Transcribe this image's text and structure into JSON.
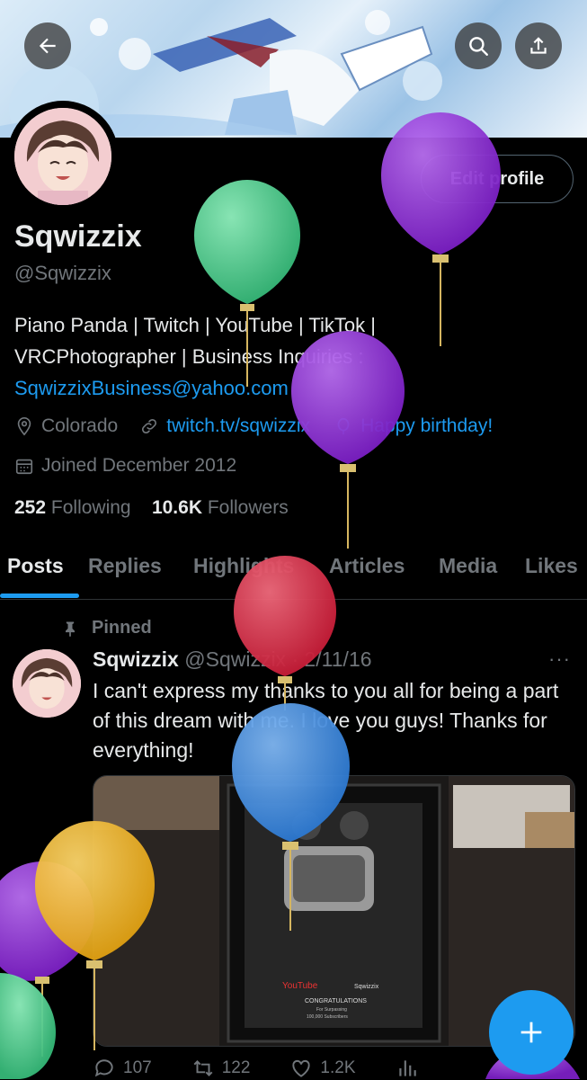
{
  "header": {
    "back_icon": "arrow-left-icon",
    "search_icon": "search-icon",
    "share_icon": "share-icon"
  },
  "profile": {
    "edit_label": "Edit profile",
    "name": "Sqwizzix",
    "handle": "@Sqwizzix",
    "bio_line1": "Piano Panda | Twitch | YouTube | TikTok |",
    "bio_line2": "VRCPhotographer | Business Inquiries :",
    "bio_email": "SqwizzixBusiness@yahoo.com",
    "location": "Colorado",
    "website": "twitch.tv/sqwizzix",
    "birthday": "Happy birthday!",
    "joined": "Joined December 2012",
    "following_count": "252",
    "following_label": "Following",
    "followers_count": "10.6K",
    "followers_label": "Followers"
  },
  "tabs": [
    "Posts",
    "Replies",
    "Highlights",
    "Articles",
    "Media",
    "Likes"
  ],
  "active_tab": "Posts",
  "post": {
    "pinned_label": "Pinned",
    "author": "Sqwizzix",
    "handle": "@Sqwizzix",
    "date": "· 2/11/16",
    "more": "···",
    "text": "I can't express my thanks to you all for being a part of this dream with me. I love you guys! Thanks for everything!",
    "media_caption_channel": "Sqwizzix",
    "media_caption_title": "CONGRATULATIONS",
    "media_caption_sub": "For Surpassing",
    "media_caption_subs": "100,000 Subscribers",
    "media_logo": "YouTube",
    "replies": "107",
    "reposts": "122",
    "likes": "1.2K"
  },
  "colors": {
    "accent": "#1d9bf0",
    "text": "#e7e9ea",
    "muted": "#71767b",
    "balloon_purple": "#8e2fd0",
    "balloon_green": "#4fd08f",
    "balloon_red": "#e0304a",
    "balloon_blue": "#3d8ee0",
    "balloon_yellow": "#f2b824"
  }
}
